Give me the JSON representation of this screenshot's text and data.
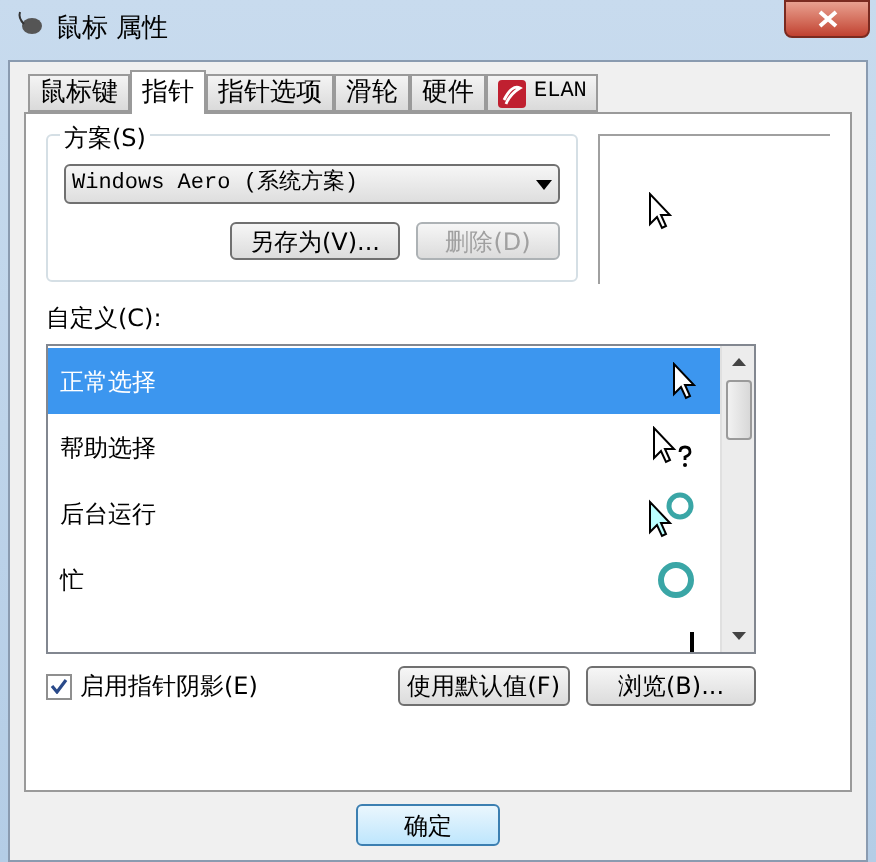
{
  "window": {
    "title": "鼠标 属性"
  },
  "tabs": [
    {
      "label": "鼠标键",
      "selected": false
    },
    {
      "label": "指针",
      "selected": true
    },
    {
      "label": "指针选项",
      "selected": false
    },
    {
      "label": "滑轮",
      "selected": false
    },
    {
      "label": "硬件",
      "selected": false
    },
    {
      "label": "ELAN",
      "selected": false,
      "kind": "logo"
    }
  ],
  "scheme": {
    "label": "方案(S)",
    "value": "Windows Aero (系统方案)",
    "buttons": [
      {
        "label": "另存为(V)...",
        "disabled": false
      },
      {
        "label": "删除(D)",
        "disabled": true
      }
    ]
  },
  "customize": {
    "label": "自定义(C):",
    "items": [
      {
        "name": "正常选择",
        "kind": "arrow",
        "selected": true
      },
      {
        "name": "帮助选择",
        "kind": "help",
        "selected": false
      },
      {
        "name": "后台运行",
        "kind": "working",
        "selected": false
      },
      {
        "name": "忙",
        "kind": "busy",
        "selected": false
      },
      {
        "kind": "text",
        "selected": false
      }
    ]
  },
  "shadow": {
    "label": "启用指针阴影(E)",
    "checked": true
  },
  "list_buttons": [
    "使用默认值(F)",
    "浏览(B)..."
  ],
  "footer_buttons": [
    "确定"
  ]
}
